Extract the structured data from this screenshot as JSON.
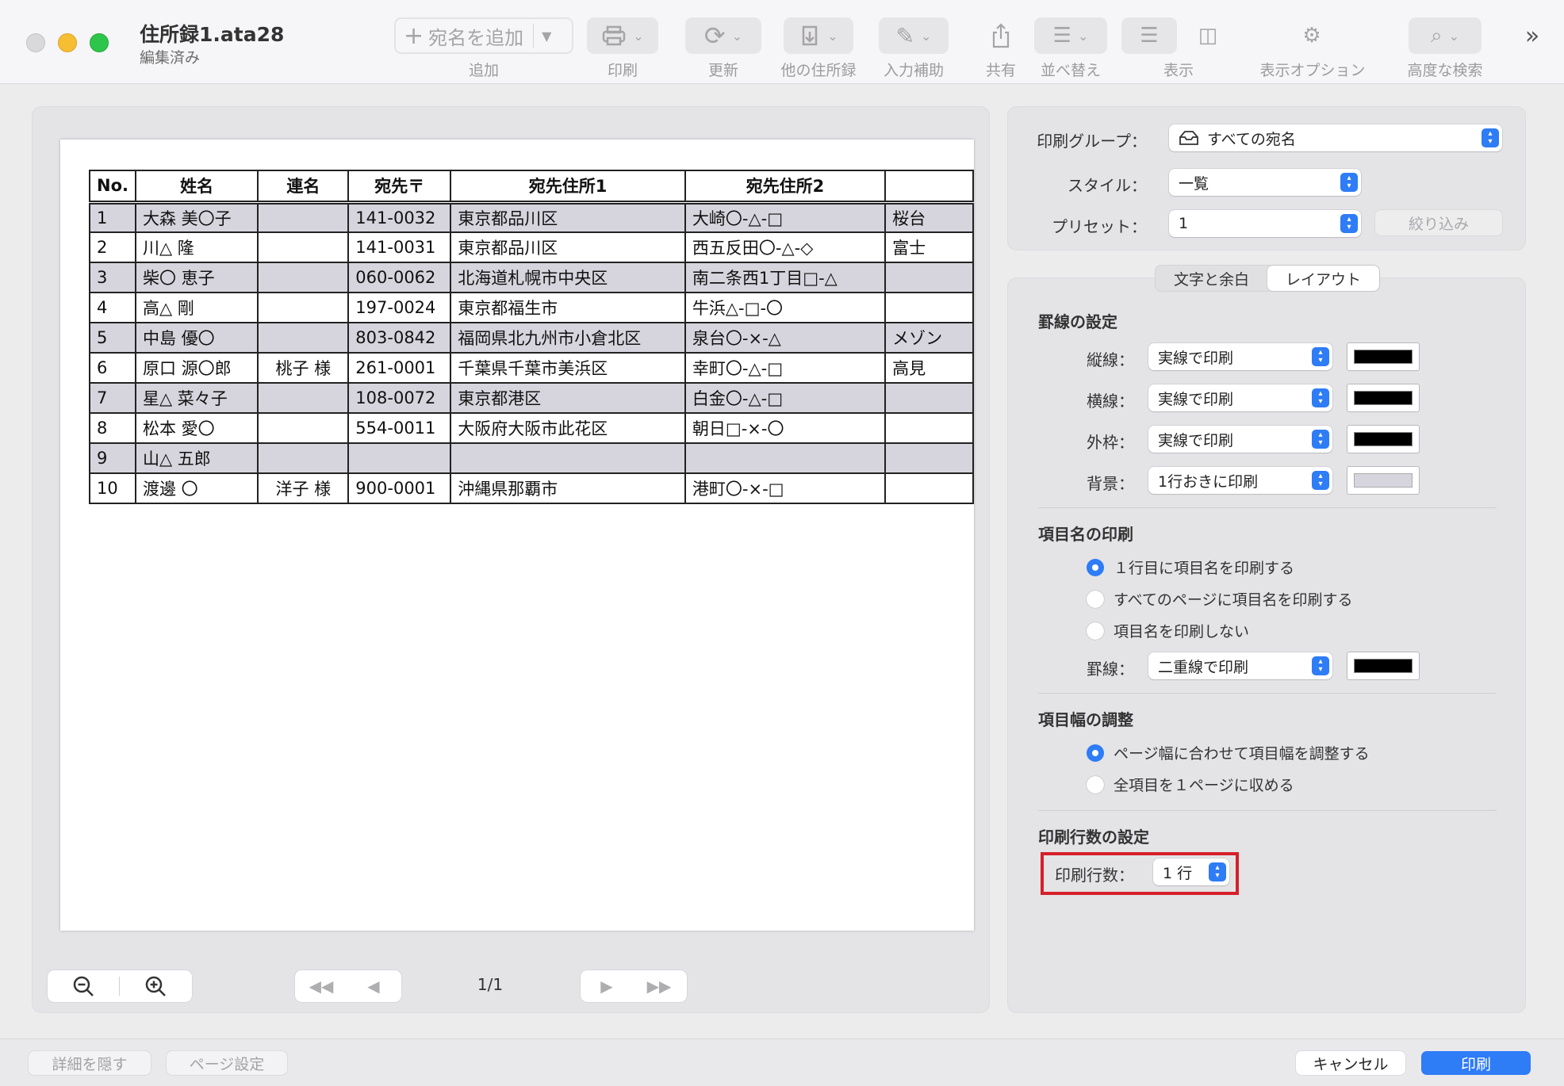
{
  "window": {
    "title": "住所録1.ata28",
    "subtitle": "編集済み"
  },
  "toolbar": {
    "add_placeholder": "宛名を追加",
    "labels": [
      "追加",
      "印刷",
      "更新",
      "他の住所録",
      "入力補助",
      "共有",
      "並べ替え",
      "表示",
      "表示オプション",
      "高度な検索"
    ],
    "overflow_icon": "chevron-double-right-icon"
  },
  "preview": {
    "headers": [
      "No.",
      "姓名",
      "連名",
      "宛先〒",
      "宛先住所1",
      "宛先住所2"
    ],
    "rows": [
      [
        "1",
        "大森 美〇子",
        "",
        "141-0032",
        "東京都品川区",
        "大崎〇-△-□",
        "桜台"
      ],
      [
        "2",
        "川△ 隆",
        "",
        "141-0031",
        "東京都品川区",
        "西五反田〇-△-◇",
        "富士"
      ],
      [
        "3",
        "柴〇 恵子",
        "",
        "060-0062",
        "北海道札幌市中央区",
        "南二条西1丁目□-△",
        ""
      ],
      [
        "4",
        "高△ 剛",
        "",
        "197-0024",
        "東京都福生市",
        "牛浜△-□-〇",
        ""
      ],
      [
        "5",
        "中島 優〇",
        "",
        "803-0842",
        "福岡県北九州市小倉北区",
        "泉台〇-×-△",
        "メゾン"
      ],
      [
        "6",
        "原口 源〇郎",
        "桃子 様",
        "261-0001",
        "千葉県千葉市美浜区",
        "幸町〇-△-□",
        "高見"
      ],
      [
        "7",
        "星△ 菜々子",
        "",
        "108-0072",
        "東京都港区",
        "白金〇-△-□",
        ""
      ],
      [
        "8",
        "松本 愛〇",
        "",
        "554-0011",
        "大阪府大阪市此花区",
        "朝日□-×-〇",
        ""
      ],
      [
        "9",
        "山△ 五郎",
        "",
        "",
        "",
        "",
        ""
      ],
      [
        "10",
        "渡邊 〇",
        "洋子 様",
        "900-0001",
        "沖縄県那覇市",
        "港町〇-×-□",
        ""
      ]
    ],
    "page_indicator": "1/1"
  },
  "settings": {
    "print_group_label": "印刷グループ：",
    "print_group_value": "すべての宛名",
    "style_label": "スタイル：",
    "style_value": "一覧",
    "preset_label": "プリセット：",
    "preset_value": "1",
    "filter_button": "絞り込み",
    "tabs": [
      "文字と余白",
      "レイアウト"
    ],
    "active_tab": "レイアウト",
    "ruled_lines": {
      "title": "罫線の設定",
      "vertical_label": "縦線：",
      "vertical_value": "実線で印刷",
      "horizontal_label": "横線：",
      "horizontal_value": "実線で印刷",
      "outer_label": "外枠：",
      "outer_value": "実線で印刷",
      "background_label": "背景：",
      "background_value": "1行おきに印刷",
      "line_color": "#000000",
      "background_color": "#d6d5dd"
    },
    "item_names": {
      "title": "項目名の印刷",
      "options": [
        "１行目に項目名を印刷する",
        "すべてのページに項目名を印刷する",
        "項目名を印刷しない"
      ],
      "selected": 0,
      "line_label": "罫線：",
      "line_value": "二重線で印刷"
    },
    "column_width": {
      "title": "項目幅の調整",
      "options": [
        "ページ幅に合わせて項目幅を調整する",
        "全項目を１ページに収める"
      ],
      "selected": 0
    },
    "row_count": {
      "title": "印刷行数の設定",
      "label": "印刷行数：",
      "value": "1 行"
    }
  },
  "bottom": {
    "hide_details": "詳細を隠す",
    "page_setup": "ページ設定",
    "cancel": "キャンセル",
    "print": "印刷"
  },
  "colors": {
    "accent": "#2e7cf6",
    "highlight": "#d5202a"
  }
}
